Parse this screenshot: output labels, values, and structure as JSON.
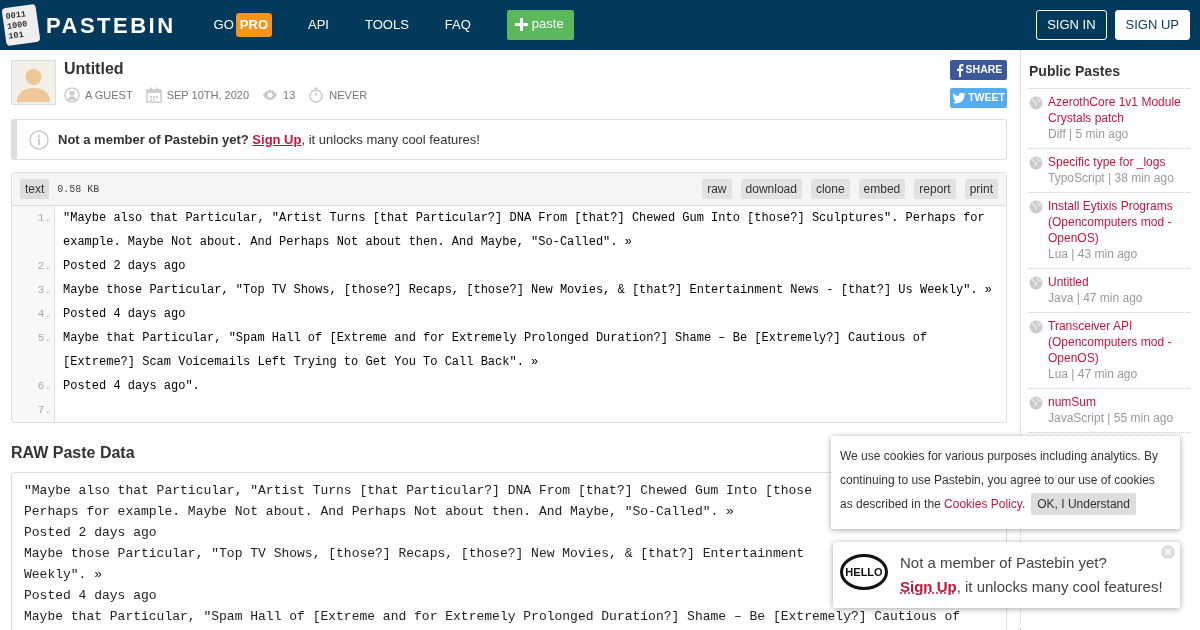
{
  "header": {
    "logo_digits": [
      "0011",
      "1000",
      "101"
    ],
    "logo_text": "PASTEBIN",
    "nav": [
      {
        "label": "GO",
        "badge": "PRO"
      },
      {
        "label": "API"
      },
      {
        "label": "TOOLS"
      },
      {
        "label": "FAQ"
      }
    ],
    "new_paste_button": {
      "label": "paste"
    },
    "auth_buttons": [
      {
        "label": "SIGN IN",
        "kind": "outline"
      },
      {
        "label": "SIGN UP",
        "kind": "solid"
      }
    ]
  },
  "paste": {
    "title": "Untitled",
    "meta": [
      {
        "kind": "user",
        "text": "A GUEST"
      },
      {
        "kind": "date",
        "text": "SEP 10TH, 2020"
      },
      {
        "kind": "views",
        "text": "13"
      },
      {
        "kind": "expiry",
        "text": "NEVER"
      }
    ],
    "share_buttons": [
      {
        "kind": "facebook",
        "label": "SHARE"
      },
      {
        "kind": "twitter",
        "label": "TWEET"
      }
    ]
  },
  "notice": {
    "bold": "Not a member of Pastebin yet?",
    "link": "Sign Up",
    "rest": ", it unlocks many cool features!"
  },
  "code_box": {
    "syntax": "text",
    "size": "0.58 KB",
    "actions": [
      "raw",
      "download",
      "clone",
      "embed",
      "report",
      "print"
    ],
    "lines": [
      {
        "number": "1.",
        "text": "\"Maybe also that Particular, \"Artist Turns [that Particular?] DNA From [that?] Chewed Gum Into [those?] Sculptures\". Perhaps for example. Maybe Not about. And Perhaps Not about then. And Maybe, \"So-Called\". »"
      },
      {
        "number": "2.",
        "text": "Posted 2 days ago"
      },
      {
        "number": "3.",
        "text": "Maybe those Particular, \"Top TV Shows, [those?] Recaps, [those?] New Movies, & [that?] Entertainment News - [that?] Us Weekly\". »"
      },
      {
        "number": "4.",
        "text": "Posted 4 days ago"
      },
      {
        "number": "5.",
        "text": "Maybe that Particular, \"Spam Hall of [Extreme and for Extremely Prolonged Duration?] Shame – Be [Extremely?] Cautious of [Extreme?] Scam Voicemails Left Trying to Get You To Call Back\". »"
      },
      {
        "number": "6.",
        "text": "Posted 4 days ago\"."
      },
      {
        "number": "7."
      }
    ]
  },
  "raw": {
    "heading": "RAW Paste Data",
    "lines": [
      "\"Maybe also that Particular, \"Artist Turns [that Particular?] DNA From [that?] Chewed Gum Into [those",
      "Perhaps for example. Maybe Not about. And Perhaps Not about then. And Maybe, \"So-Called\". »",
      "Posted 2 days ago",
      "Maybe those Particular, \"Top TV Shows, [those?] Recaps, [those?] New Movies, & [that?] Entertainment",
      "Weekly\". »",
      "Posted 4 days ago",
      "Maybe that Particular, \"Spam Hall of [Extreme and for Extremely Prolonged Duration?] Shame – Be [Extremely?] Cautious of"
    ]
  },
  "sidebar": {
    "heading": "Public Pastes",
    "items": [
      {
        "title": "AzerothCore 1v1 Module Crystals patch",
        "meta": "Diff | 5 min ago"
      },
      {
        "title": "Specific type for _logs",
        "meta": "TypoScript | 38 min ago"
      },
      {
        "title": "Install Eytixis Programs (Opencomputers mod - OpenOS)",
        "meta": "Lua | 43 min ago"
      },
      {
        "title": "Untitled",
        "meta": "Java | 47 min ago"
      },
      {
        "title": "Transceiver API (Opencomputers mod - OpenOS)",
        "meta": "Lua | 47 min ago"
      },
      {
        "title": "numSum",
        "meta": "JavaScript | 55 min ago"
      }
    ]
  },
  "cookie_banner": {
    "text_lines": [
      "We use cookies for various purposes including analytics. By",
      "continuing to use Pastebin, you agree to our use of cookies"
    ],
    "last_line": "as described in the ",
    "link": "Cookies Policy",
    "after": ".",
    "button": "OK, I Understand"
  },
  "signup_popup": {
    "bubble": "HELLO",
    "line1": "Not a member of Pastebin yet?",
    "link": "Sign Up",
    "rest": ", it unlocks many cool features!"
  }
}
